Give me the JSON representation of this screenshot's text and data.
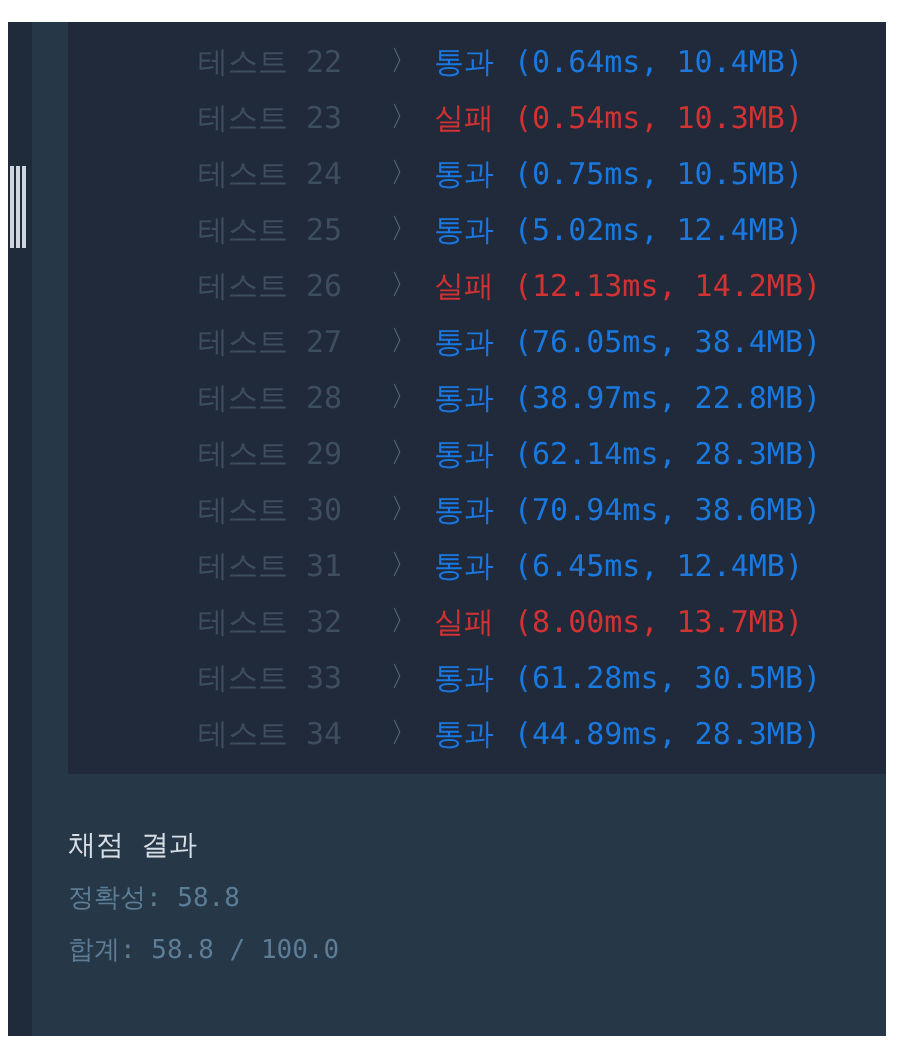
{
  "results": [
    {
      "label": "테스트 22",
      "chevron": "〉",
      "status": "통과",
      "detail": "(0.64ms, 10.4MB)",
      "passed": true
    },
    {
      "label": "테스트 23",
      "chevron": "〉",
      "status": "실패",
      "detail": "(0.54ms, 10.3MB)",
      "passed": false
    },
    {
      "label": "테스트 24",
      "chevron": "〉",
      "status": "통과",
      "detail": "(0.75ms, 10.5MB)",
      "passed": true
    },
    {
      "label": "테스트 25",
      "chevron": "〉",
      "status": "통과",
      "detail": "(5.02ms, 12.4MB)",
      "passed": true
    },
    {
      "label": "테스트 26",
      "chevron": "〉",
      "status": "실패",
      "detail": "(12.13ms, 14.2MB)",
      "passed": false
    },
    {
      "label": "테스트 27",
      "chevron": "〉",
      "status": "통과",
      "detail": "(76.05ms, 38.4MB)",
      "passed": true
    },
    {
      "label": "테스트 28",
      "chevron": "〉",
      "status": "통과",
      "detail": "(38.97ms, 22.8MB)",
      "passed": true
    },
    {
      "label": "테스트 29",
      "chevron": "〉",
      "status": "통과",
      "detail": "(62.14ms, 28.3MB)",
      "passed": true
    },
    {
      "label": "테스트 30",
      "chevron": "〉",
      "status": "통과",
      "detail": "(70.94ms, 38.6MB)",
      "passed": true
    },
    {
      "label": "테스트 31",
      "chevron": "〉",
      "status": "통과",
      "detail": "(6.45ms, 12.4MB)",
      "passed": true
    },
    {
      "label": "테스트 32",
      "chevron": "〉",
      "status": "실패",
      "detail": "(8.00ms, 13.7MB)",
      "passed": false
    },
    {
      "label": "테스트 33",
      "chevron": "〉",
      "status": "통과",
      "detail": "(61.28ms, 30.5MB)",
      "passed": true
    },
    {
      "label": "테스트 34",
      "chevron": "〉",
      "status": "통과",
      "detail": "(44.89ms, 28.3MB)",
      "passed": true
    }
  ],
  "summary": {
    "title": "채점 결과",
    "accuracy": "정확성: 58.8",
    "total": "합계: 58.8 / 100.0"
  }
}
